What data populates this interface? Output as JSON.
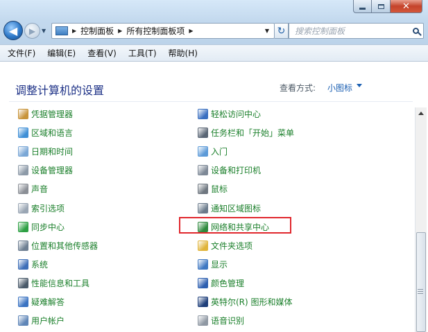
{
  "window": {
    "close_glyph": "✕"
  },
  "nav": {
    "back_glyph": "◀",
    "forward_glyph": "▶",
    "breadcrumb": [
      "控制面板",
      "所有控制面板项"
    ],
    "refresh_glyph": "↻",
    "search_placeholder": "搜索控制面板"
  },
  "menu": [
    "文件(F)",
    "编辑(E)",
    "查看(V)",
    "工具(T)",
    "帮助(H)"
  ],
  "page": {
    "title": "调整计算机的设置",
    "view_by_label": "查看方式:",
    "view_by_value": "小图标"
  },
  "items_left": [
    {
      "label": "凭据管理器",
      "icon": "credential-manager-icon",
      "color": "#c8943a"
    },
    {
      "label": "区域和语言",
      "icon": "region-language-icon",
      "color": "#3f8fd6"
    },
    {
      "label": "日期和时间",
      "icon": "date-time-icon",
      "color": "#7aa7d6"
    },
    {
      "label": "设备管理器",
      "icon": "device-manager-icon",
      "color": "#8d9aa8"
    },
    {
      "label": "声音",
      "icon": "sound-icon",
      "color": "#8b8f96"
    },
    {
      "label": "索引选项",
      "icon": "indexing-options-icon",
      "color": "#9aa6b4"
    },
    {
      "label": "同步中心",
      "icon": "sync-center-icon",
      "color": "#2ea044"
    },
    {
      "label": "位置和其他传感器",
      "icon": "location-sensors-icon",
      "color": "#6e7f92"
    },
    {
      "label": "系统",
      "icon": "system-icon",
      "color": "#3e6fb8"
    },
    {
      "label": "性能信息和工具",
      "icon": "performance-tools-icon",
      "color": "#4a5a6a"
    },
    {
      "label": "疑难解答",
      "icon": "troubleshooting-icon",
      "color": "#3a73c2"
    },
    {
      "label": "用户帐户",
      "icon": "user-accounts-icon",
      "color": "#5f86b8"
    }
  ],
  "items_right": [
    {
      "label": "轻松访问中心",
      "icon": "ease-of-access-icon",
      "color": "#3a6fc0"
    },
    {
      "label": "任务栏和「开始」菜单",
      "icon": "taskbar-start-menu-icon",
      "color": "#5a6675"
    },
    {
      "label": "入门",
      "icon": "getting-started-icon",
      "color": "#5c9ad8"
    },
    {
      "label": "设备和打印机",
      "icon": "devices-printers-icon",
      "color": "#7d8896"
    },
    {
      "label": "鼠标",
      "icon": "mouse-icon",
      "color": "#6f7780"
    },
    {
      "label": "通知区域图标",
      "icon": "notification-area-icon",
      "color": "#6b7b8c"
    },
    {
      "label": "网络和共享中心",
      "icon": "network-sharing-icon",
      "color": "#2f8a3e"
    },
    {
      "label": "文件夹选项",
      "icon": "folder-options-icon",
      "color": "#e0b43a"
    },
    {
      "label": "显示",
      "icon": "display-icon",
      "color": "#3f78c2"
    },
    {
      "label": "颜色管理",
      "icon": "color-management-icon",
      "color": "#2d5fb0"
    },
    {
      "label": "英特尔(R) 图形和媒体",
      "icon": "intel-graphics-icon",
      "color": "#1f3f7a"
    },
    {
      "label": "语音识别",
      "icon": "speech-recognition-icon",
      "color": "#8f98a3"
    }
  ],
  "colors": {
    "highlight_box": "#e0262c",
    "link_green": "#1a7f2a",
    "title_blue": "#1e3287"
  }
}
